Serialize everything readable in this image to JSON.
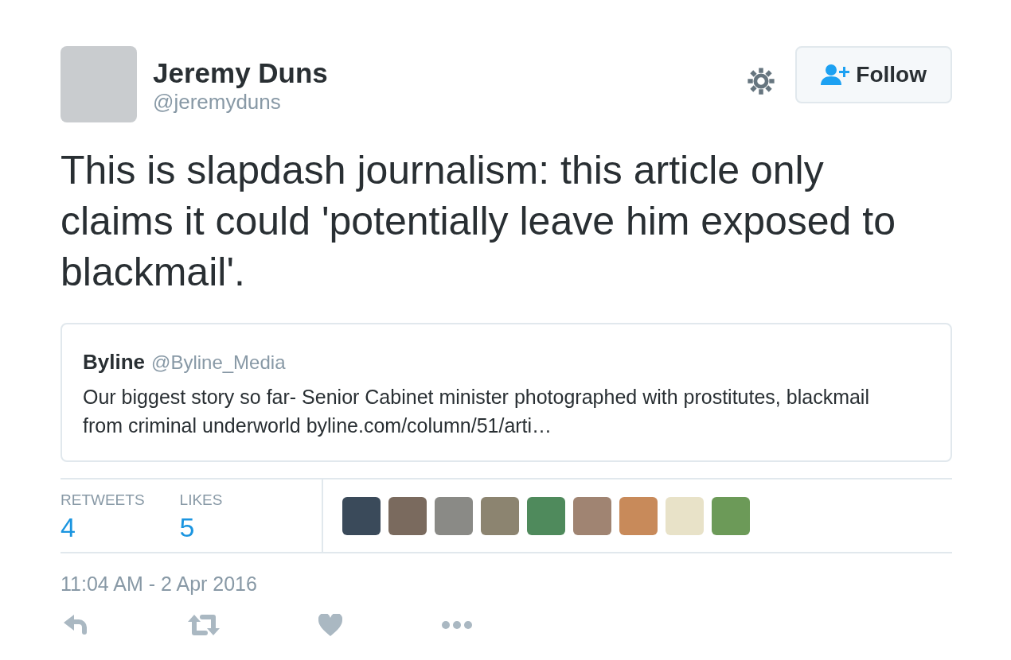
{
  "author": {
    "name": "Jeremy Duns",
    "handle": "@jeremyduns"
  },
  "follow_button": {
    "label": "Follow"
  },
  "tweet_text": "This is slapdash journalism: this article only claims it could 'potentially leave him exposed to blackmail'.",
  "quoted_tweet": {
    "name": "Byline",
    "handle": "@Byline_Media",
    "text": "Our biggest story so far- Senior Cabinet minister photographed with prostitutes, blackmail from criminal underworld",
    "link": "byline.com/column/51/arti…"
  },
  "stats": [
    {
      "label": "RETWEETS",
      "value": "4"
    },
    {
      "label": "LIKES",
      "value": "5"
    }
  ],
  "timestamp": "11:04 AM - 2 Apr 2016"
}
